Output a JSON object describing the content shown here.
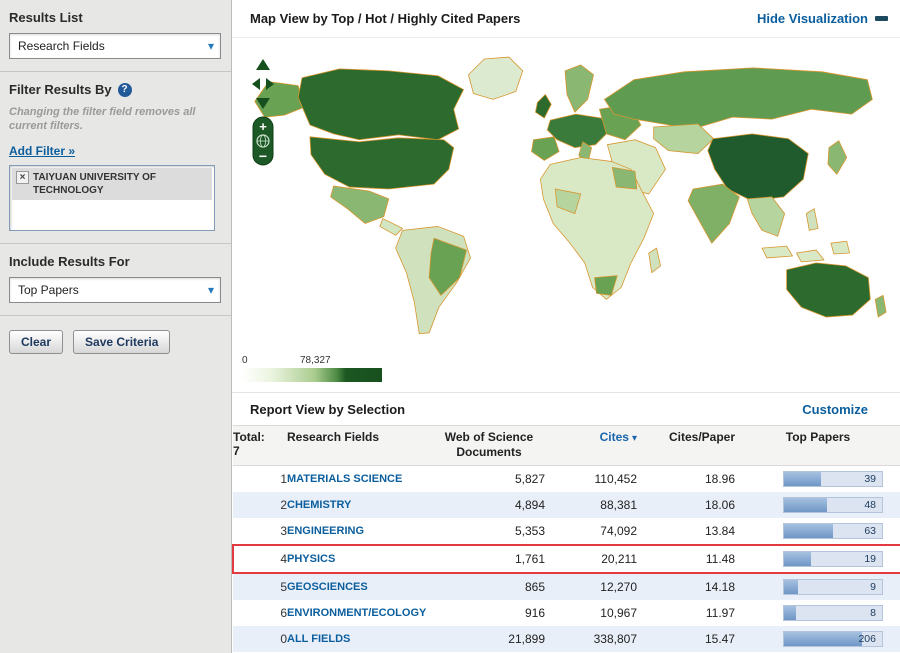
{
  "icons": {
    "chevron_down": "▾",
    "help": "?",
    "remove": "×",
    "plus": "+",
    "minus": "−",
    "sort_caret": "▾"
  },
  "sidebar": {
    "results_list": {
      "label": "Results List",
      "value": "Research Fields"
    },
    "filter": {
      "title": "Filter Results By",
      "note": "Changing the filter field removes all current filters.",
      "add_filter": "Add Filter »",
      "selected_filter": "TAIYUAN UNIVERSITY OF TECHNOLOGY"
    },
    "include": {
      "label": "Include Results For",
      "value": "Top Papers"
    },
    "buttons": {
      "clear": "Clear",
      "save": "Save Criteria"
    }
  },
  "map_panel": {
    "title": "Map View by Top / Hot / Highly Cited Papers",
    "hide_link": "Hide Visualization",
    "legend": {
      "min": "0",
      "max": "78,327"
    }
  },
  "report": {
    "title": "Report View by Selection",
    "customize": "Customize",
    "header": {
      "total_label": "Total:",
      "total_value": "7",
      "fields": "Research Fields",
      "docs": "Web of Science Documents",
      "cites": "Cites",
      "cites_per_paper": "Cites/Paper",
      "top_papers": "Top Papers"
    },
    "rows": [
      {
        "rank": "1",
        "field": "MATERIALS SCIENCE",
        "docs": "5,827",
        "cites": "110,452",
        "cites_per_paper": "18.96",
        "top_papers": "39",
        "bar_pct": 38,
        "highlighted": false
      },
      {
        "rank": "2",
        "field": "CHEMISTRY",
        "docs": "4,894",
        "cites": "88,381",
        "cites_per_paper": "18.06",
        "top_papers": "48",
        "bar_pct": 44,
        "highlighted": false
      },
      {
        "rank": "3",
        "field": "ENGINEERING",
        "docs": "5,353",
        "cites": "74,092",
        "cites_per_paper": "13.84",
        "top_papers": "63",
        "bar_pct": 50,
        "highlighted": false
      },
      {
        "rank": "4",
        "field": "PHYSICS",
        "docs": "1,761",
        "cites": "20,211",
        "cites_per_paper": "11.48",
        "top_papers": "19",
        "bar_pct": 28,
        "highlighted": true
      },
      {
        "rank": "5",
        "field": "GEOSCIENCES",
        "docs": "865",
        "cites": "12,270",
        "cites_per_paper": "14.18",
        "top_papers": "9",
        "bar_pct": 14,
        "highlighted": false
      },
      {
        "rank": "6",
        "field": "ENVIRONMENT/ECOLOGY",
        "docs": "916",
        "cites": "10,967",
        "cites_per_paper": "11.97",
        "top_papers": "8",
        "bar_pct": 12,
        "highlighted": false
      },
      {
        "rank": "0",
        "field": "ALL FIELDS",
        "docs": "21,899",
        "cites": "338,807",
        "cites_per_paper": "15.47",
        "top_papers": "206",
        "bar_pct": 80,
        "highlighted": false
      }
    ]
  }
}
